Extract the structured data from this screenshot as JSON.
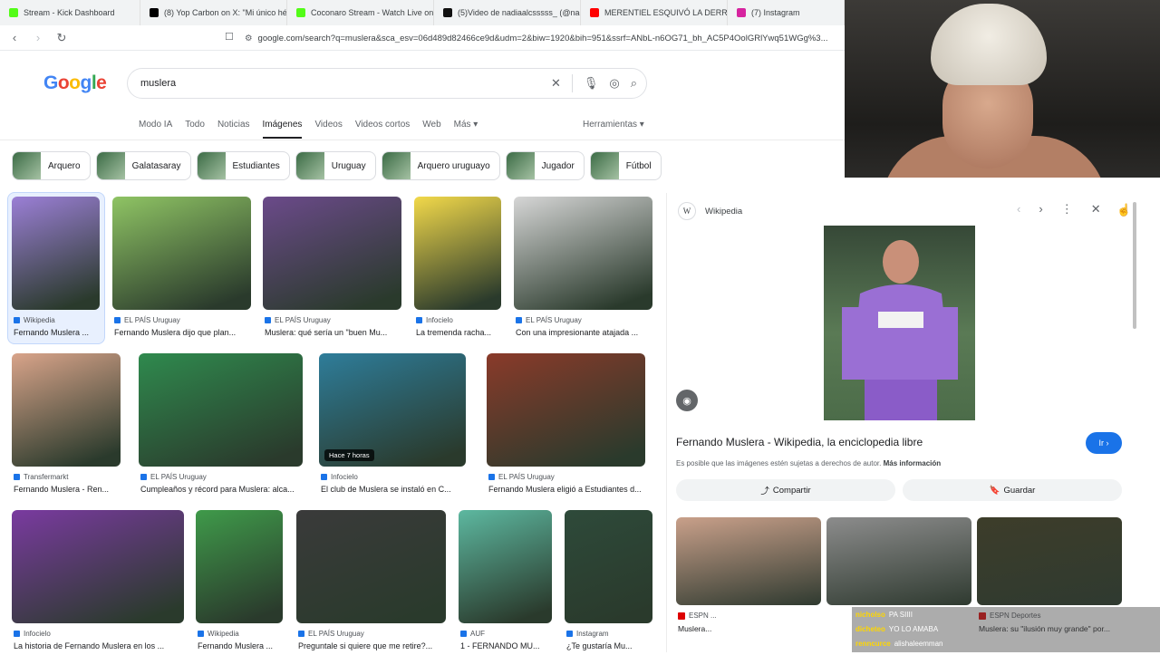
{
  "browser": {
    "tabs": [
      {
        "label": "Stream - Kick Dashboard",
        "color": "#53fc18"
      },
      {
        "label": "(8) Yop Carbon on X: \"Mi único héro",
        "color": "#000000"
      },
      {
        "label": "Coconaro Stream - Watch Live on Ki",
        "color": "#53fc18"
      },
      {
        "label": "(5)Video de nadiaalcsssss_ (@nadiaa",
        "color": "#111111"
      },
      {
        "label": "MERENTIEL ESQUIVÓ LA DERROTA Y",
        "color": "#ff0000"
      },
      {
        "label": "(7) Instagram",
        "color": "#d6249f"
      }
    ],
    "url": "google.com/search?q=muslera&sca_esv=06d489d82466ce9d&udm=2&biw=1920&bih=951&ssrf=ANbL-n6OG71_bh_AC5P4OolGRlYwq51WGg%3..."
  },
  "google": {
    "logo": [
      "G",
      "o",
      "o",
      "g",
      "l",
      "e"
    ],
    "query": "muslera",
    "tabs": [
      "Modo IA",
      "Todo",
      "Noticias",
      "Imágenes",
      "Videos",
      "Videos cortos",
      "Web",
      "Más ▾"
    ],
    "tools": "Herramientas ▾",
    "chips": [
      "Arquero",
      "Galatasaray",
      "Estudiantes",
      "Uruguay",
      "Arquero uruguayo",
      "Jugador",
      "Fútbol"
    ]
  },
  "results": {
    "row1": [
      {
        "source": "Wikipedia",
        "title": "Fernando Muslera ...",
        "color": "#9b7fd6"
      },
      {
        "source": "EL PAÍS Uruguay",
        "title": "Fernando Muslera dijo que plan...",
        "color": "#8fc464"
      },
      {
        "source": "EL PAÍS Uruguay",
        "title": "Muslera: qué sería un \"buen Mu...",
        "color": "#6b4a8a"
      },
      {
        "source": "Infocielo",
        "title": "La tremenda racha...",
        "color": "#f2d94a"
      },
      {
        "source": "EL PAÍS Uruguay",
        "title": "Con una impresionante atajada ...",
        "color": "#d6d6d6"
      }
    ],
    "row2": [
      {
        "source": "Transfermarkt",
        "title": "Fernando Muslera - Ren...",
        "color": "#d9a48a"
      },
      {
        "source": "EL PAÍS Uruguay",
        "title": "Cumpleaños y récord para Muslera: alca...",
        "color": "#2f8a4e"
      },
      {
        "source": "Infocielo",
        "title": "El club de Muslera se instaló en C...",
        "color": "#2e7d9a",
        "badge": "Hace 7 horas"
      },
      {
        "source": "EL PAÍS Uruguay",
        "title": "Fernando Muslera eligió a Estudiantes d...",
        "color": "#8a3a2a"
      }
    ],
    "row3": [
      {
        "source": "Infocielo",
        "title": "La historia de Fernando Muslera en los ...",
        "color": "#7a3aa0"
      },
      {
        "source": "Wikipedia",
        "title": "Fernando Muslera ...",
        "color": "#3f9a4a"
      },
      {
        "source": "EL PAÍS Uruguay",
        "title": "Preguntale si quiere que me retire?...",
        "color": "#3a3a3a"
      },
      {
        "source": "AUF",
        "title": "1 - FERNANDO MU...",
        "color": "#5db8a0"
      },
      {
        "source": "Instagram",
        "title": "¿Te gustaría Mu...",
        "color": "#2e4a3a"
      }
    ]
  },
  "panel": {
    "source": "Wikipedia",
    "title": "Fernando Muslera - Wikipedia, la enciclopedia libre",
    "go": "Ir ›",
    "copyright": "Es posible que las imágenes estén sujetas a derechos de autor.",
    "more_info": "Más información",
    "share": "Compartir",
    "save": "Guardar",
    "related": [
      {
        "source": "ESPN ...",
        "title": "Muslera...",
        "color": "#c9a08a"
      },
      {
        "source": "",
        "title": "",
        "color": "#8c8c8c"
      },
      {
        "source": "ESPN Deportes",
        "title": "Muslera: su \"ilusión muy grande\" por...",
        "color": "#3d3d2a"
      }
    ]
  },
  "chat": [
    {
      "user": "nicholso",
      "msg": "PA SIIII"
    },
    {
      "user": "dicheteo",
      "msg": "YO LO AMABA"
    },
    {
      "user": "renncurce",
      "msg": "alishaleemman"
    }
  ]
}
